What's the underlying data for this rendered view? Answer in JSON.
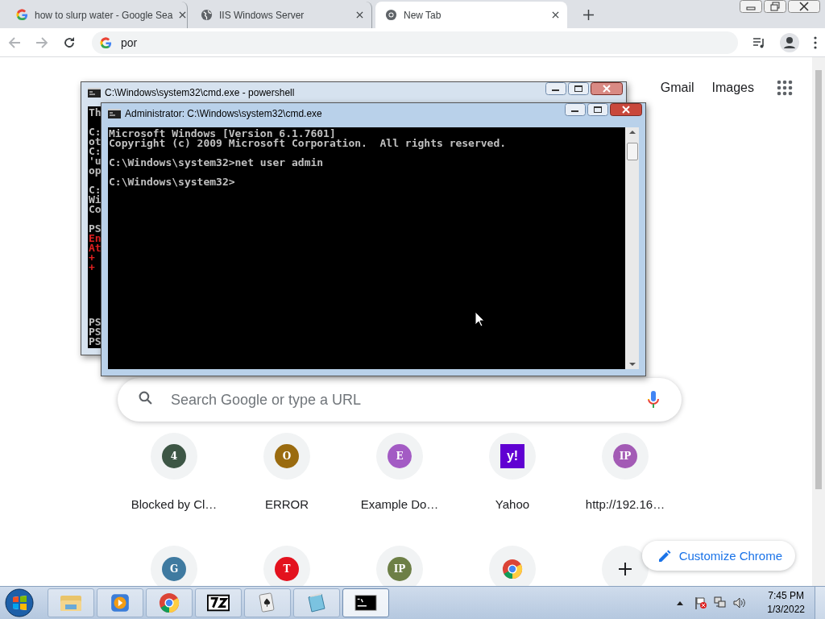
{
  "tabs": [
    {
      "title": "how to slurp water - Google Sea",
      "kind": "google",
      "selected": false
    },
    {
      "title": "IIS Windows Server",
      "kind": "globe",
      "selected": false
    },
    {
      "title": "New Tab",
      "kind": "chrome",
      "selected": true
    }
  ],
  "address": {
    "value": "por"
  },
  "top_links": [
    "Gmail",
    "Images"
  ],
  "search": {
    "placeholder": "Search Google or type a URL"
  },
  "shortcuts": [
    {
      "kind": "letter",
      "letter": "4",
      "color": "#3d5645",
      "label": "Blocked by Cl…"
    },
    {
      "kind": "letter",
      "letter": "O",
      "color": "#9a6b0f",
      "label": "ERROR"
    },
    {
      "kind": "letter",
      "letter": "E",
      "color": "#a35bc4",
      "label": "Example Do…"
    },
    {
      "kind": "yahoo",
      "letter": "y!",
      "color": "#6001d2",
      "label": "Yahoo"
    },
    {
      "kind": "letter",
      "letter": "IP",
      "color": "#a35bb5",
      "label": "http://192.16…"
    },
    {
      "kind": "letter",
      "letter": "G",
      "color": "#3f7aa0"
    },
    {
      "kind": "letter",
      "letter": "T",
      "color": "#e3121e"
    },
    {
      "kind": "letter",
      "letter": "IP",
      "color": "#6d7f46"
    },
    {
      "kind": "chrome"
    },
    {
      "kind": "add"
    }
  ],
  "customize": {
    "label": "Customize Chrome"
  },
  "windows": [
    {
      "title": "C:\\Windows\\system32\\cmd.exe - powershell",
      "active": false,
      "blocks": [
        [
          {
            "text": "Th",
            "error": false
          }
        ],
        [
          {
            "text": "C:",
            "error": false
          },
          {
            "text": "ot",
            "error": false
          },
          {
            "text": "C:",
            "error": false
          },
          {
            "text": "'u",
            "error": false
          },
          {
            "text": "op",
            "error": false
          }
        ],
        [
          {
            "text": "C:",
            "error": false
          },
          {
            "text": "Wi",
            "error": false
          },
          {
            "text": "Co",
            "error": false
          }
        ],
        [
          {
            "text": "PS",
            "error": false
          },
          {
            "text": "En",
            "error": true
          },
          {
            "text": "At",
            "error": true
          },
          {
            "text": "+",
            "error": true
          },
          {
            "text": "+",
            "error": true
          }
        ]
      ],
      "bottom_lines": [
        "PS",
        "PS",
        "PS"
      ]
    },
    {
      "title": "Administrator: C:\\Windows\\system32\\cmd.exe",
      "active": true,
      "blocks": [
        [
          {
            "text": "Microsoft Windows [Version 6.1.7601]",
            "error": false
          },
          {
            "text": "Copyright (c) 2009 Microsoft Corporation.  All rights reserved.",
            "error": false
          }
        ],
        [
          {
            "text": "C:\\Windows\\system32>net user admin",
            "error": false
          }
        ],
        [
          {
            "text": "C:\\Windows\\system32>",
            "error": false
          }
        ]
      ]
    }
  ],
  "taskbar": [
    {
      "kind": "explorer",
      "selected": false
    },
    {
      "kind": "media",
      "selected": false
    },
    {
      "kind": "chrome",
      "selected": false
    },
    {
      "kind": "archive",
      "selected": false
    },
    {
      "kind": "cards",
      "selected": false
    },
    {
      "kind": "notepad",
      "selected": false
    },
    {
      "kind": "cmd",
      "selected": true
    }
  ],
  "clock": {
    "time": "7:45 PM",
    "date": "1/3/2022"
  }
}
